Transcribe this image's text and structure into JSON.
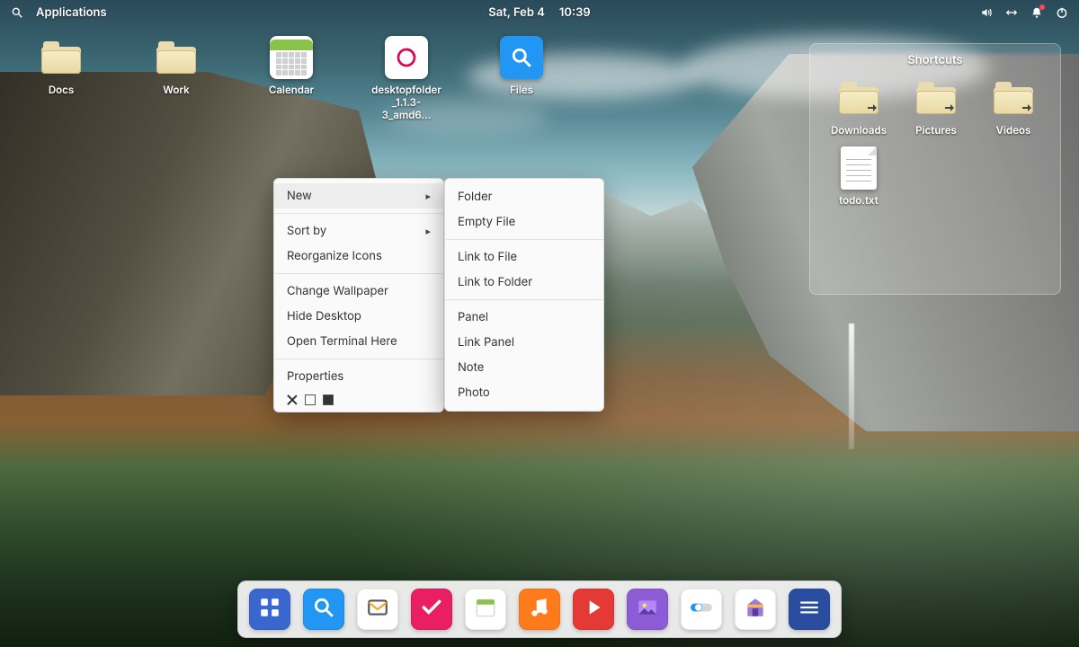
{
  "topbar": {
    "apps_label": "Applications",
    "date": "Sat, Feb  4",
    "time": "10:39"
  },
  "desktop": {
    "icons": [
      {
        "name": "docs-folder",
        "kind": "folder",
        "label": "Docs"
      },
      {
        "name": "work-folder",
        "kind": "folder",
        "label": "Work"
      },
      {
        "name": "calendar-app",
        "kind": "calendar",
        "label": "Calendar"
      },
      {
        "name": "deb-package",
        "kind": "deb",
        "label": "desktopfolder_1.1.3-3_amd6…"
      },
      {
        "name": "files-app",
        "kind": "files",
        "label": "Files"
      }
    ]
  },
  "context_menu": {
    "items": [
      {
        "label": "New",
        "submenu": true,
        "hover": true
      },
      {
        "sep": true
      },
      {
        "label": "Sort by",
        "submenu": true
      },
      {
        "label": "Reorganize Icons"
      },
      {
        "sep": true
      },
      {
        "label": "Change Wallpaper"
      },
      {
        "label": "Hide Desktop"
      },
      {
        "label": "Open Terminal Here"
      },
      {
        "sep": true
      },
      {
        "label": "Properties"
      }
    ],
    "submenu_items": [
      {
        "label": "Folder"
      },
      {
        "label": "Empty File"
      },
      {
        "sep": true
      },
      {
        "label": "Link to File"
      },
      {
        "label": "Link to Folder"
      },
      {
        "sep": true
      },
      {
        "label": "Panel"
      },
      {
        "label": "Link Panel"
      },
      {
        "label": "Note"
      },
      {
        "label": "Photo"
      }
    ]
  },
  "shortcuts": {
    "title": "Shortcuts",
    "items": [
      {
        "name": "downloads-link",
        "kind": "folder-link",
        "label": "Downloads"
      },
      {
        "name": "pictures-link",
        "kind": "folder-link",
        "label": "Pictures"
      },
      {
        "name": "videos-link",
        "kind": "folder-link",
        "label": "Videos"
      },
      {
        "name": "todo-file",
        "kind": "text-file",
        "label": "todo.txt"
      }
    ]
  },
  "dock": {
    "apps": [
      {
        "name": "multitasking",
        "bg": "#3a66d0"
      },
      {
        "name": "files",
        "bg": "#2196f3"
      },
      {
        "name": "mail",
        "bg": "#ffffff"
      },
      {
        "name": "tasks",
        "bg": "#e91e63"
      },
      {
        "name": "calendar",
        "bg": "#ffffff"
      },
      {
        "name": "music",
        "bg": "#ff7a1a"
      },
      {
        "name": "videos",
        "bg": "#e53935"
      },
      {
        "name": "photos",
        "bg": "#8e5bd6"
      },
      {
        "name": "settings",
        "bg": "#ffffff"
      },
      {
        "name": "appcenter",
        "bg": "#ffffff"
      },
      {
        "name": "terminal",
        "bg": "#2a4da0"
      }
    ]
  },
  "colors": {
    "menu_bg": "#fafafa",
    "accent": "#2196f3"
  }
}
